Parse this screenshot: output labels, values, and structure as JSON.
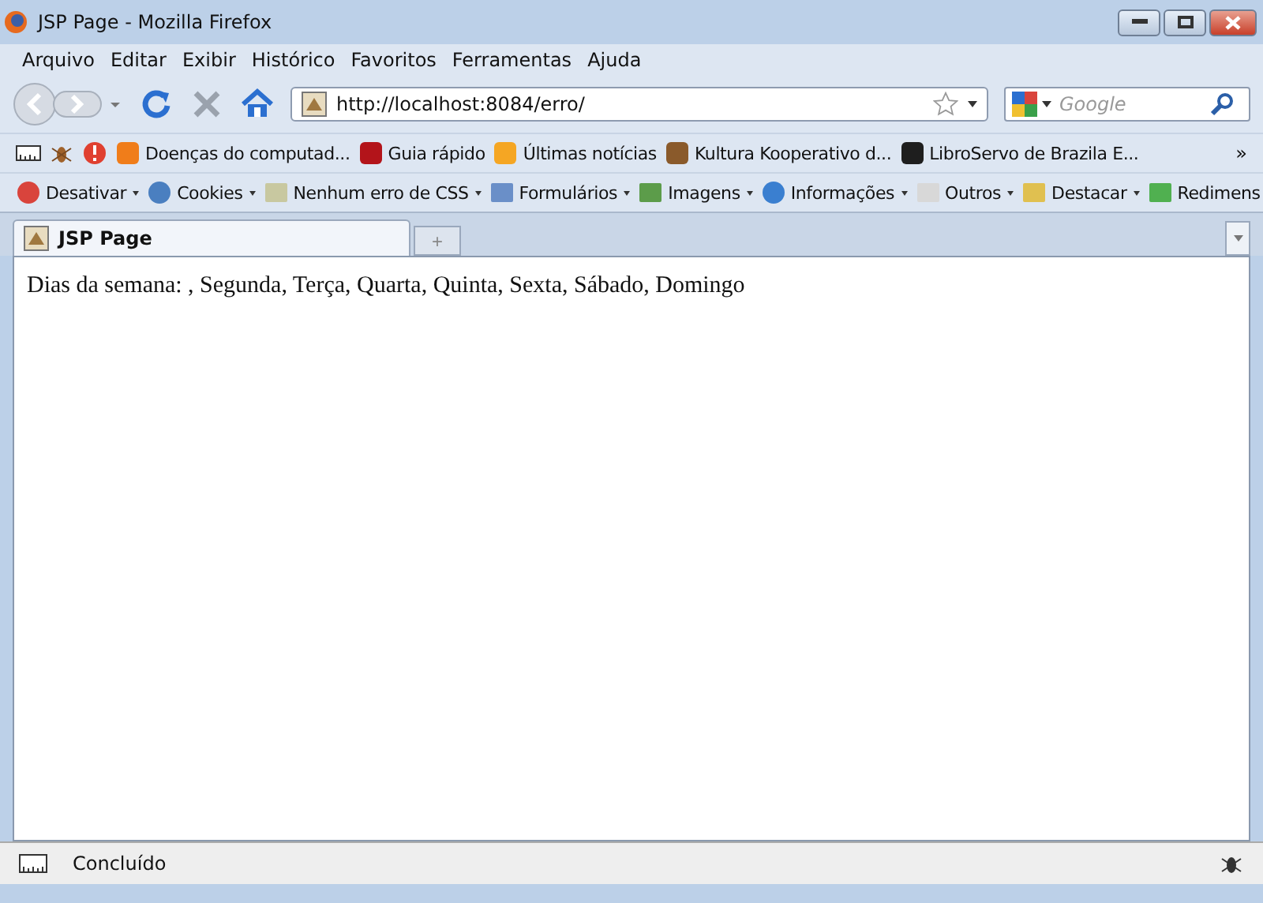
{
  "window": {
    "title": "JSP Page - Mozilla Firefox"
  },
  "menu": [
    "Arquivo",
    "Editar",
    "Exibir",
    "Histórico",
    "Favoritos",
    "Ferramentas",
    "Ajuda"
  ],
  "address_bar": {
    "value": "http://localhost:8084/erro/"
  },
  "search": {
    "placeholder": "Google"
  },
  "bookmarks": [
    "Doenças do computad...",
    "Guia rápido",
    "Últimas notícias",
    "Kultura Kooperativo d...",
    "LibroServo de Brazila E..."
  ],
  "bookmarks_overflow": "»",
  "developer_toolbar": [
    "Desativar",
    "Cookies",
    "Nenhum erro de CSS",
    "Formulários",
    "Imagens",
    "Informações",
    "Outros",
    "Destacar",
    "Redimens"
  ],
  "tabs": [
    {
      "label": "JSP Page",
      "selected": true
    }
  ],
  "new_tab": "+",
  "page": {
    "text": "Dias da semana: , Segunda, Terça, Quarta, Quinta, Sexta, Sábado, Domingo"
  },
  "status_bar": {
    "text": "Concluído"
  }
}
